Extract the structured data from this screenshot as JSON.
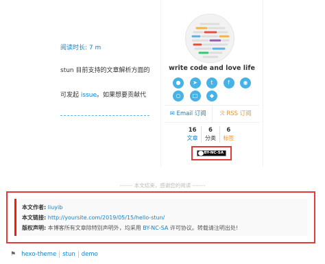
{
  "article": {
    "reading_time": "阅读时长: 7 m",
    "snippet_1": "stun 目前支持的文章解析方面的",
    "snippet_2_pre": "可发起 ",
    "snippet_2_link": "issue",
    "snippet_2_post": "。如果想要贡献代"
  },
  "sidebar": {
    "description": "write code and love life",
    "social_icons": [
      "github-icon",
      "telegram-icon",
      "twitter-icon",
      "facebook-icon",
      "weibo-icon",
      "wechat-icon",
      "bilibili-icon",
      "qq-icon"
    ],
    "email_label": "Email 订阅",
    "rss_label": "RSS 订阅",
    "stats": [
      {
        "num": "16",
        "label": "文章"
      },
      {
        "num": "6",
        "label": "分类"
      },
      {
        "num": "6",
        "label": "标签"
      }
    ],
    "cc_badge_text": "BY-NC-SA"
  },
  "end_text": "------- 本文结束，感谢您的阅读 -------",
  "copyright": {
    "author_label": "本文作者:",
    "author_value": "liuyib",
    "link_label": "本文链接:",
    "link_value": "http://yoursite.com/2019/05/15/hello-stun/",
    "license_label": "版权声明:",
    "license_pre": "本博客所有文章除特别声明外，均采用 ",
    "license_link": "BY-NC-SA",
    "license_post": " 许可协议。转载请注明出处!"
  },
  "tags": [
    "hexo-theme",
    "stun",
    "demo"
  ],
  "colors": {
    "accent": "#0e83cd",
    "orange": "#ff8c1a",
    "highlight_red": "#e53935",
    "social_blue": "#47b2e6"
  }
}
